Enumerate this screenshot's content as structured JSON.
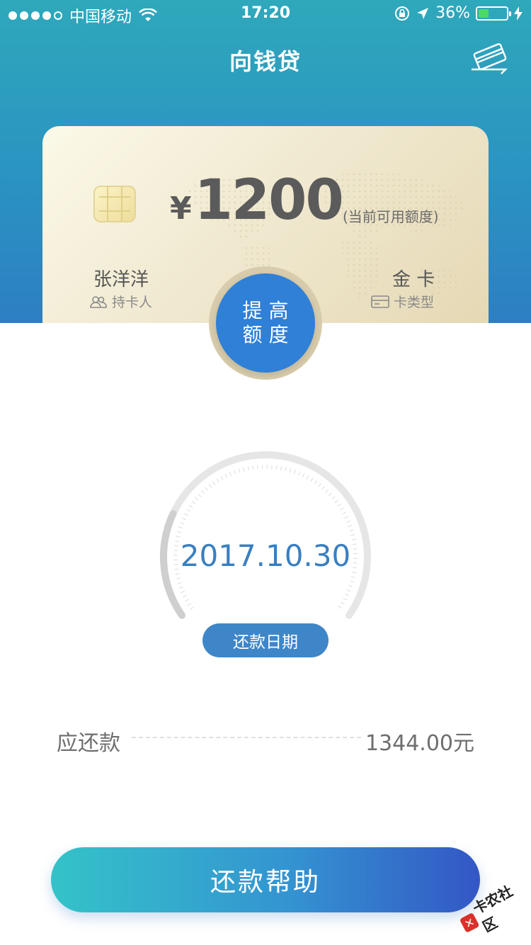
{
  "status_bar": {
    "carrier": "中国移动",
    "time": "17:20",
    "battery_percent": "36%",
    "battery_level": 0.36,
    "signal_bars": 4
  },
  "nav": {
    "title": "向钱贷",
    "right_icon": "card-icon"
  },
  "card": {
    "currency": "¥",
    "amount": "1200",
    "amount_label": "(当前可用额度)",
    "holder_name": "张洋洋",
    "holder_label": "持卡人",
    "card_type": "金 卡",
    "card_type_label": "卡类型"
  },
  "raise_button": {
    "line1": "提 高",
    "line2": "额 度"
  },
  "due": {
    "date": "2017.10.30",
    "label": "还款日期"
  },
  "repay": {
    "label": "应还款",
    "value": "1344.00元"
  },
  "help_button": {
    "label": "还款帮助"
  },
  "watermark": {
    "text": "卡农社区"
  },
  "colors": {
    "header_top": "#2fa8bb",
    "header_bottom": "#2d7fc3",
    "accent_blue": "#2f80d6",
    "date_blue": "#3a7fc0",
    "battery_green": "#4cd964"
  }
}
